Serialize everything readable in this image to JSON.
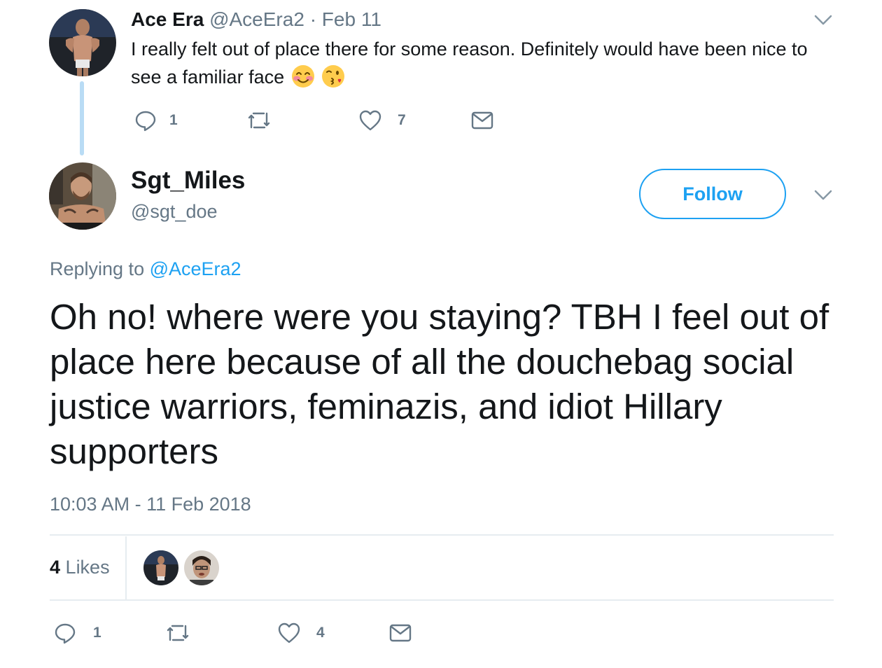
{
  "parent_tweet": {
    "name": "Ace Era",
    "handle": "@AceEra2",
    "separator": "·",
    "date": "Feb 11",
    "text": "I really felt out of place there for some reason. Definitely would have been nice to see a familiar face",
    "emojis": [
      "smiling-face-with-smiling-eyes-emoji",
      "face-blowing-a-kiss-emoji"
    ],
    "actions": {
      "reply_count": "1",
      "retweet_count": "",
      "like_count": "7"
    }
  },
  "main_tweet": {
    "name": "Sgt_Miles",
    "handle": "@sgt_doe",
    "follow_label": "Follow",
    "replying_prefix": "Replying to",
    "replying_to": "@AceEra2",
    "text": "Oh no! where were you staying? TBH I feel out of place here because of all the douchebag social justice warriors, feminazis, and idiot Hillary supporters",
    "timestamp": "10:03 AM - 11 Feb 2018",
    "likes": {
      "count": "4",
      "label": "Likes"
    },
    "actions": {
      "reply_count": "1",
      "retweet_count": "",
      "like_count": "4"
    }
  },
  "colors": {
    "text": "#14171a",
    "secondary": "#657786",
    "accent": "#1da1f2",
    "thread_line": "#b9dcf5",
    "divider": "#e6ecf0"
  },
  "icons": [
    "reply-icon",
    "retweet-icon",
    "like-icon",
    "direct-message-icon",
    "chevron-down-icon"
  ]
}
